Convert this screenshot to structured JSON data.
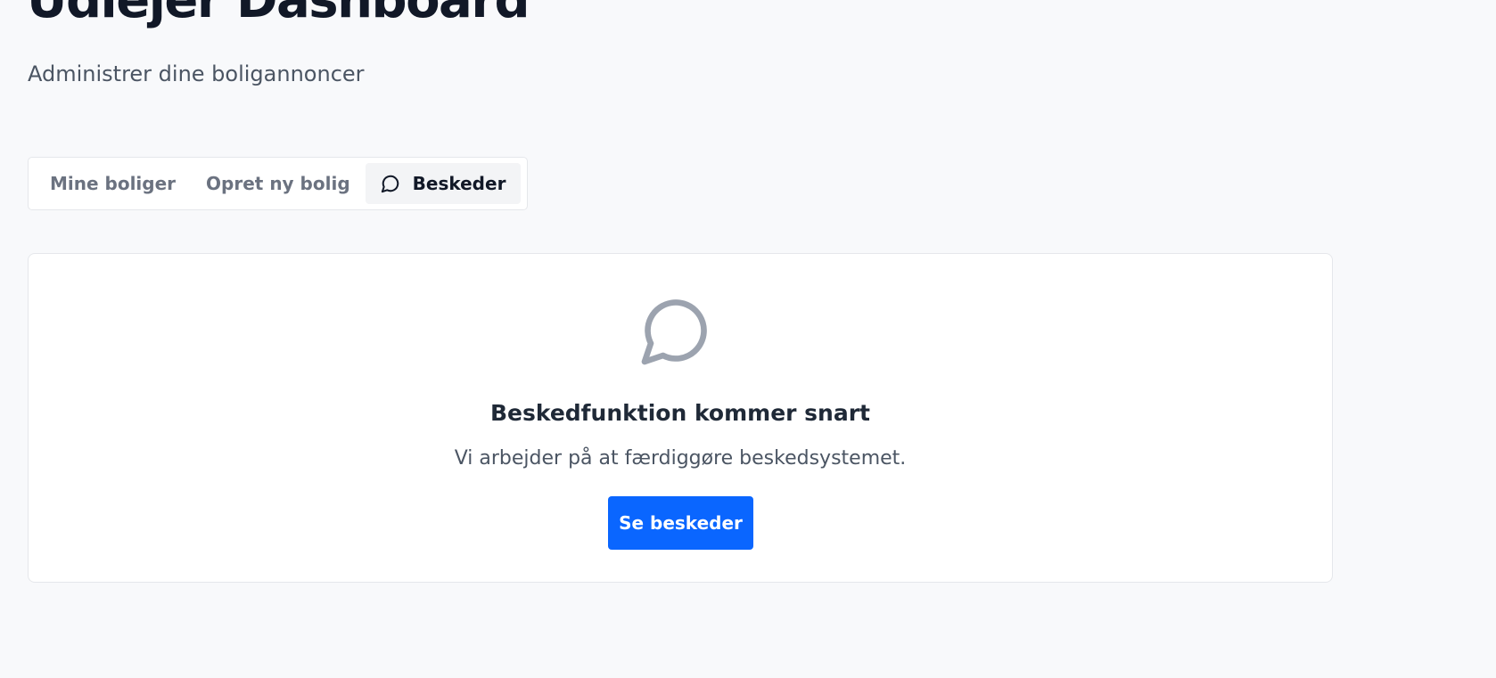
{
  "header": {
    "title": "Udlejer Dashboard",
    "subtitle": "Administrer dine boligannoncer"
  },
  "tabs": [
    {
      "label": "Mine boliger",
      "active": false
    },
    {
      "label": "Opret ny bolig",
      "active": false
    },
    {
      "label": "Beskeder",
      "active": true,
      "icon": "message-circle-icon"
    }
  ],
  "messages_panel": {
    "icon": "message-circle-icon",
    "title": "Beskedfunktion kommer snart",
    "description": "Vi arbejder på at færdiggøre beskedsystemet.",
    "button_label": "Se beskeder"
  },
  "colors": {
    "background": "#f8f9fb",
    "primary_button": "#0a66ff",
    "icon_gray": "#9ca3af"
  }
}
